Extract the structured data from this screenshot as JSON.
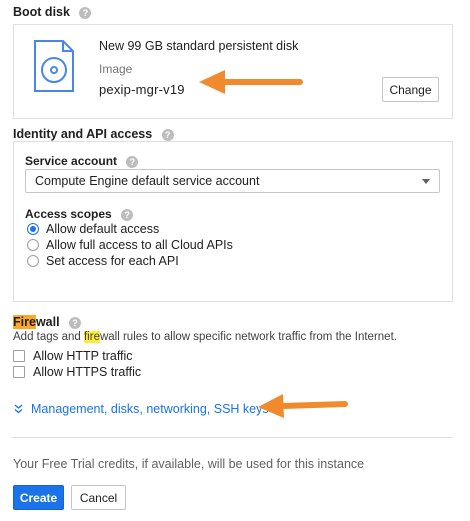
{
  "boot_disk": {
    "title": "Boot disk",
    "disk_title": "New 99 GB standard persistent disk",
    "image_label": "Image",
    "image_value": "pexip-mgr-v19",
    "change_label": "Change"
  },
  "identity": {
    "title": "Identity and API access",
    "service_account_label": "Service account",
    "service_account_value": "Compute Engine default service account",
    "access_scopes_label": "Access scopes",
    "scopes": [
      {
        "label": "Allow default access",
        "selected": true
      },
      {
        "label": "Allow full access to all Cloud APIs",
        "selected": false
      },
      {
        "label": "Set access for each API",
        "selected": false
      }
    ]
  },
  "firewall": {
    "title_prefix": "Fire",
    "title_suffix": "wall",
    "desc_before": "Add tags and ",
    "desc_highlight": "fire",
    "desc_after": "wall rules to allow specific network traffic from the Internet.",
    "options": [
      {
        "label": "Allow HTTP traffic",
        "checked": false
      },
      {
        "label": "Allow HTTPS traffic",
        "checked": false
      }
    ]
  },
  "management_link": "Management, disks, networking, SSH keys",
  "trial_notice": "Your Free Trial credits, if available, will be used for this instance",
  "actions": {
    "create_label": "Create",
    "cancel_label": "Cancel"
  },
  "icons": {
    "help": "help-icon",
    "disk": "disk-icon",
    "dropdown": "chevron-down-icon",
    "expand": "double-chevron-down-icon",
    "annotation": "arrow-icon"
  },
  "colors": {
    "accent": "#1a73e8",
    "annotation_arrow": "#f08a2c",
    "highlight_yellow": "#ffeb3b",
    "highlight_orange": "#ffa726"
  }
}
